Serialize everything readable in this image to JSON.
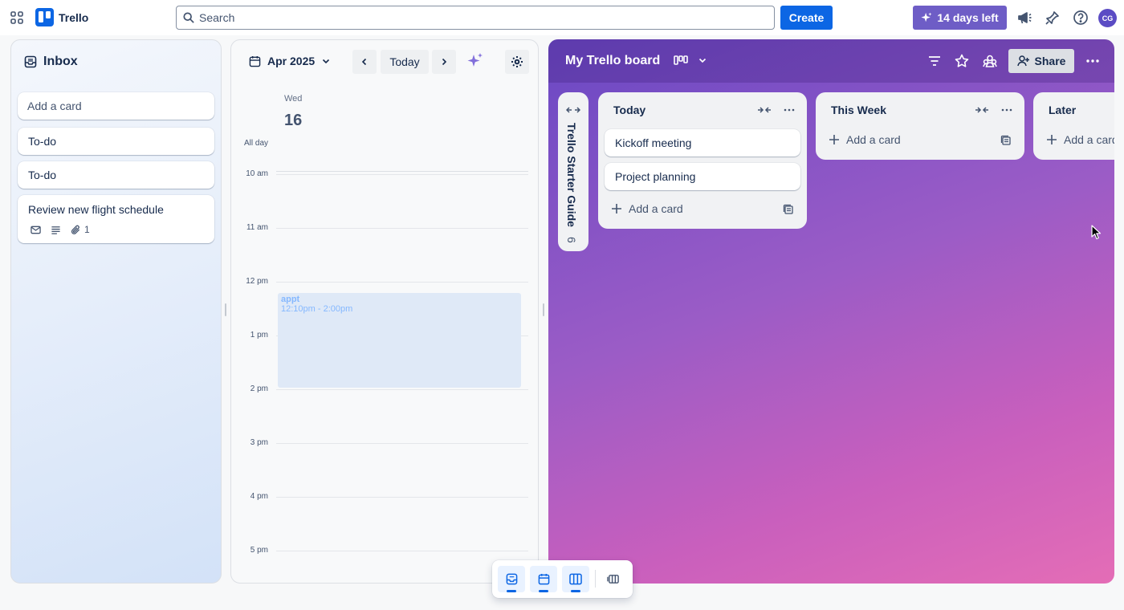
{
  "topbar": {
    "app_name": "Trello",
    "search_placeholder": "Search",
    "create_label": "Create",
    "trial_label": "14 days left",
    "avatar_initials": "CG",
    "brand_color": "#0c66e4",
    "trial_color": "#6e5dc6"
  },
  "inbox": {
    "title": "Inbox",
    "add_card_label": "Add a card",
    "cards": [
      {
        "title": "To-do"
      },
      {
        "title": "To-do"
      },
      {
        "title": "Review new flight schedule",
        "attachments": "1"
      }
    ]
  },
  "calendar": {
    "month_label": "Apr 2025",
    "today_label": "Today",
    "day_of_week": "Wed",
    "day_number": "16",
    "all_day_label": "All day",
    "hours": [
      "10 am",
      "11 am",
      "12 pm",
      "1 pm",
      "2 pm",
      "3 pm",
      "4 pm",
      "5 pm"
    ],
    "event": {
      "title": "appt",
      "time": "12:10pm - 2:00pm"
    }
  },
  "board": {
    "title": "My Trello board",
    "share_label": "Share",
    "collapsed_list": {
      "title": "Trello Starter Guide",
      "count": "6"
    },
    "lists": [
      {
        "title": "Today",
        "cards": [
          "Kickoff meeting",
          "Project planning"
        ],
        "add_label": "Add a card"
      },
      {
        "title": "This Week",
        "cards": [],
        "add_label": "Add a card"
      },
      {
        "title": "Later",
        "cards": [],
        "add_label": "Add a card"
      }
    ]
  },
  "switcher": {
    "items": [
      "inbox-icon",
      "calendar-icon",
      "board-icon",
      "switch-boards-icon"
    ]
  }
}
